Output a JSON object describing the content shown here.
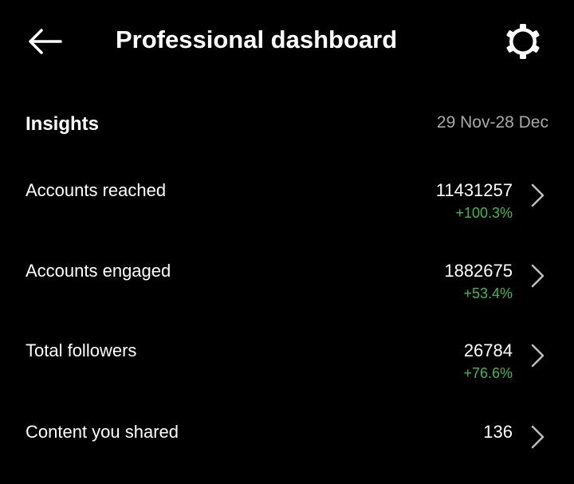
{
  "header": {
    "title": "Professional dashboard",
    "back_icon": "arrow-left-icon",
    "settings_icon": "gear-icon"
  },
  "insights": {
    "title": "Insights",
    "date_range": "29 Nov-28 Dec",
    "metrics": [
      {
        "label": "Accounts reached",
        "value": "11431257",
        "change": "+100.3%"
      },
      {
        "label": "Accounts engaged",
        "value": "1882675",
        "change": "+53.4%"
      },
      {
        "label": "Total followers",
        "value": "26784",
        "change": "+76.6%"
      },
      {
        "label": "Content you shared",
        "value": "136"
      }
    ]
  },
  "colors": {
    "background": "#000000",
    "text": "#ffffff",
    "secondary_text": "#a8a8a8",
    "positive_change": "#3fb950"
  }
}
